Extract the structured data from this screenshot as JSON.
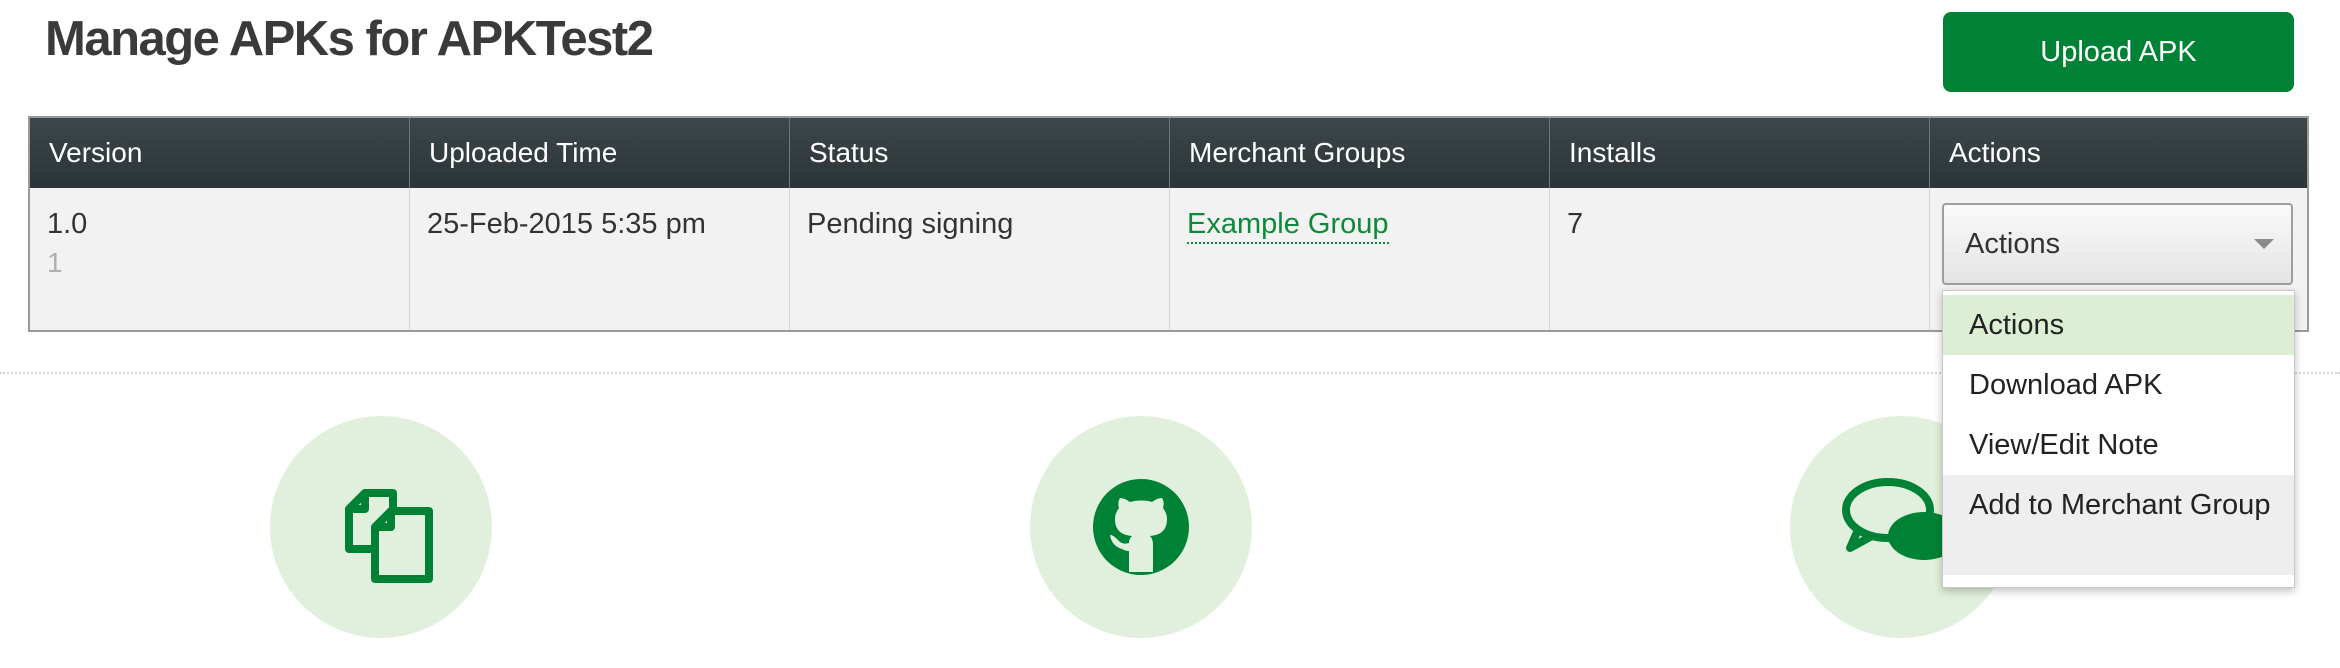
{
  "page": {
    "title": "Manage APKs for APKTest2",
    "upload_button": "Upload APK"
  },
  "table": {
    "headers": [
      "Version",
      "Uploaded Time",
      "Status",
      "Merchant Groups",
      "Installs",
      "Actions"
    ],
    "rows": [
      {
        "version": "1.0",
        "version_code": "1",
        "uploaded_time": "25-Feb-2015 5:35 pm",
        "status": "Pending signing",
        "merchant_group": "Example Group",
        "installs": "7",
        "actions_selected": "Actions"
      }
    ]
  },
  "actions_menu": {
    "options": [
      "Actions",
      "Download APK",
      "View/Edit Note",
      "Add to Merchant Group"
    ],
    "selected": "Actions",
    "highlighted": "Add to Merchant Group"
  },
  "features": {
    "icons": [
      "documents-icon",
      "github-icon",
      "chat-bubbles-icon"
    ]
  },
  "colors": {
    "brand_green": "#008236",
    "link_green": "#0c8a3a",
    "header_dark": "#2b3437",
    "circle_bg": "#e1f0dc",
    "selected_bg": "#dcefd4"
  }
}
